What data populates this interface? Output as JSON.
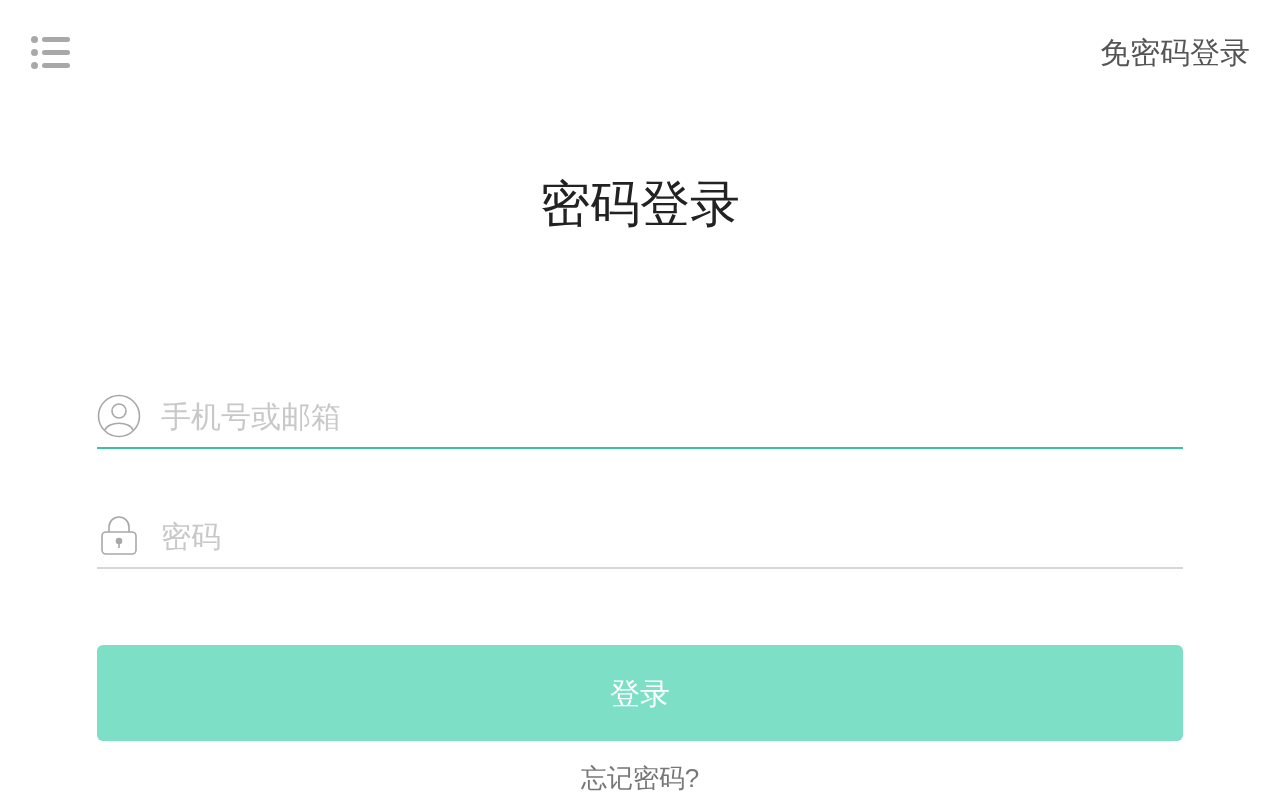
{
  "header": {
    "switch_link": "免密码登录"
  },
  "title": "密码登录",
  "fields": [
    {
      "kind": "account",
      "placeholder": "手机号或邮箱",
      "focused": true
    },
    {
      "kind": "password",
      "placeholder": "密码",
      "focused": false
    }
  ],
  "login_button": {
    "label": "登录",
    "disabled": true
  },
  "forgot_link": "忘记密码?"
}
